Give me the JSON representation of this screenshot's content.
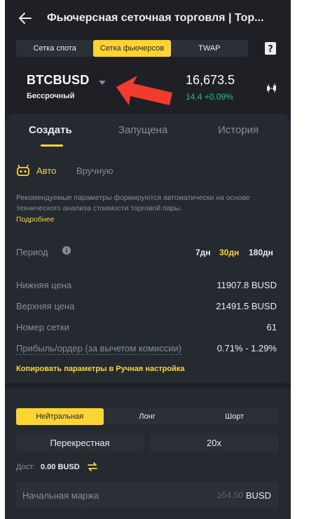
{
  "header": {
    "title": "Фьючерсная сеточная торговля | Тор..."
  },
  "mode_tabs": [
    {
      "label": "Сетка спота",
      "active": false
    },
    {
      "label": "Сетка фьючерсов",
      "active": true
    },
    {
      "label": "TWAP",
      "active": false
    }
  ],
  "pair": {
    "symbol": "BTCBUSD",
    "contract_type": "Бессрочный",
    "price": "16,673.5",
    "change": "14.4 +0.09%"
  },
  "tabs": [
    {
      "label": "Создать",
      "active": true
    },
    {
      "label": "Запущена",
      "active": false
    },
    {
      "label": "История",
      "active": false
    }
  ],
  "mode_switch": {
    "auto": "Авто",
    "manual": "Вручную"
  },
  "description": "Рекомендуемые параметры формируются автоматически на основе технического анализа стоимости торговой пары.",
  "more_link": "Подробнее",
  "period": {
    "label": "Период",
    "options": [
      {
        "label": "7дн",
        "active": false
      },
      {
        "label": "30дн",
        "active": true
      },
      {
        "label": "180дн",
        "active": false
      }
    ]
  },
  "params": [
    {
      "label": "Нижняя цена",
      "value": "11907.8 BUSD"
    },
    {
      "label": "Верхняя цена",
      "value": "21491.5 BUSD"
    },
    {
      "label": "Номер сетки",
      "value": "61"
    },
    {
      "label": "Прибыль/ордер (за вычетом комиссии)",
      "value": "0.71% - 1.29%"
    }
  ],
  "copy_link": "Копировать параметры в Ручная настройка",
  "direction_tabs": [
    {
      "label": "Нейтральная",
      "active": true
    },
    {
      "label": "Лонг",
      "active": false
    },
    {
      "label": "Шорт",
      "active": false
    }
  ],
  "margin_mode": "Перекрестная",
  "leverage": "20x",
  "available": {
    "label": "Дост:",
    "value": "0.00 BUSD"
  },
  "initial_margin": {
    "placeholder": "Начальная маржа",
    "min": "≥54.50",
    "unit": "BUSD"
  },
  "colors": {
    "accent": "#fcd535",
    "positive": "#0ecb81",
    "annotation_arrow": "#f23b2c",
    "background": "#1e2026"
  }
}
